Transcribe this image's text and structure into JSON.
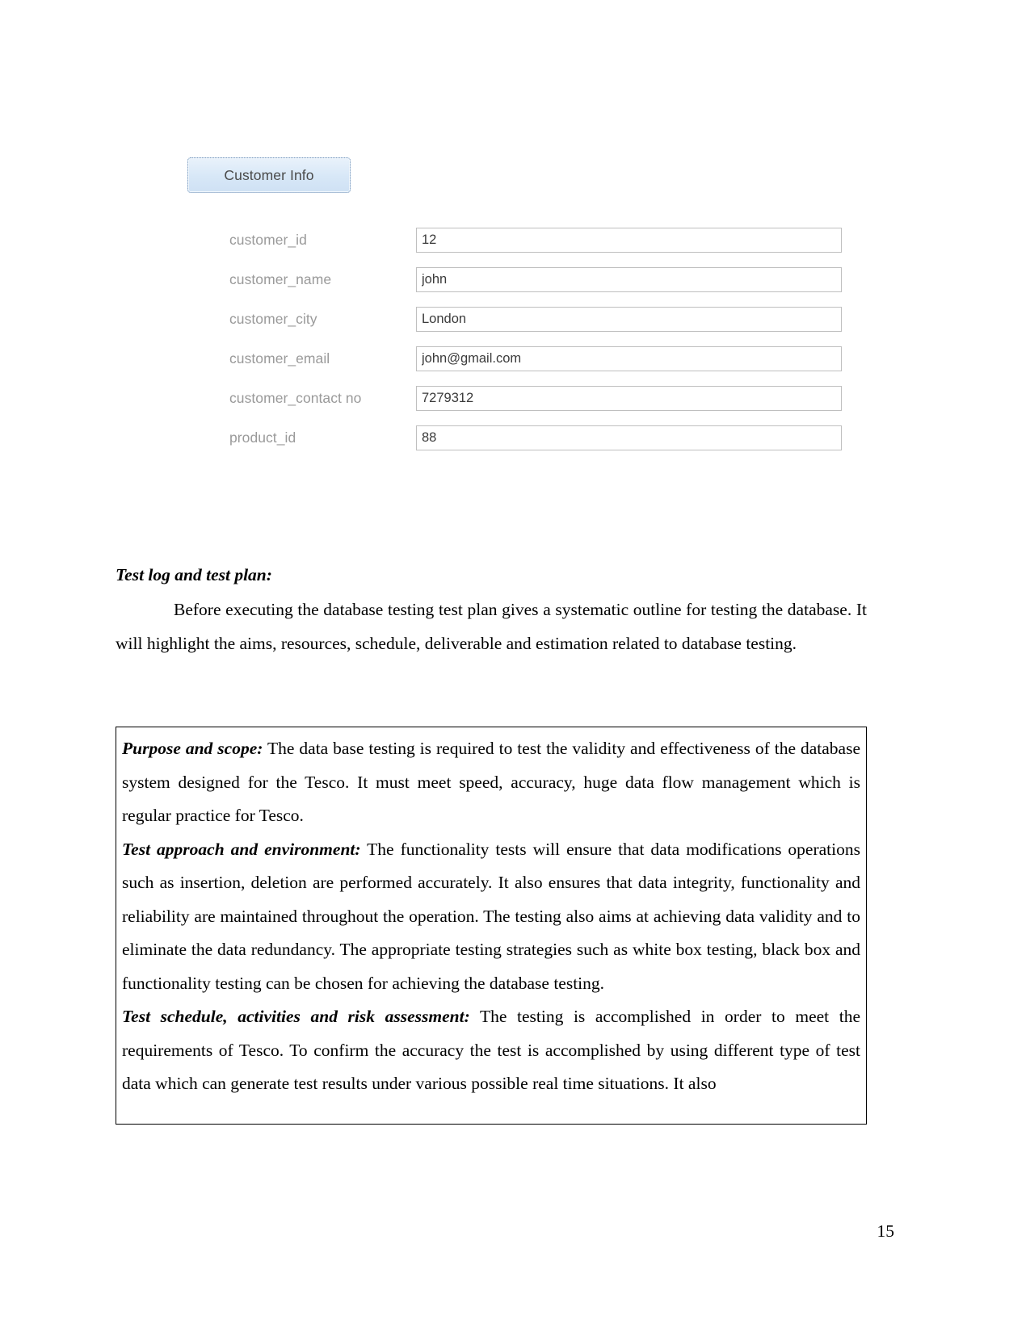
{
  "page": {
    "number": "15"
  },
  "app_screenshot": {
    "tab_label": "Customer Info",
    "accent_color": "#d7e7f7",
    "border_color": "#6f8fb5",
    "label_color": "#9a9a9a",
    "fields": [
      {
        "label": "customer_id",
        "value": "12"
      },
      {
        "label": "customer_name",
        "value": "john"
      },
      {
        "label": "customer_city",
        "value": "London"
      },
      {
        "label": "customer_email",
        "value": "john@gmail.com"
      },
      {
        "label": "customer_contact no",
        "value": "7279312"
      },
      {
        "label": "product_id",
        "value": "88"
      }
    ]
  },
  "document": {
    "section_heading": "Test log and test plan:",
    "intro_paragraph": "Before executing the database testing test plan gives a systematic outline for testing the database. It will highlight the aims, resources, schedule, deliverable and estimation related to database testing.",
    "boxed_blocks": [
      {
        "lead": "Purpose and scope:",
        "text": " The data base testing is required to test the validity and effectiveness of the database system designed for the Tesco. It must meet speed, accuracy, huge data flow management which is regular practice for Tesco."
      },
      {
        "lead": "Test approach and environment:",
        "text": " The functionality tests will ensure that data modifications operations such as insertion, deletion are performed accurately. It also ensures that data integrity, functionality and reliability are maintained throughout the operation. The testing also aims at achieving data validity and to eliminate the data redundancy. The appropriate testing strategies such as white box testing, black box and functionality testing can be chosen for achieving the database testing."
      },
      {
        "lead": "Test schedule, activities and risk assessment:",
        "text": " The testing is accomplished in order to meet the requirements of Tesco. To confirm the accuracy the test is accomplished by using different type of test data which can generate test results under various possible real time situations. It also"
      }
    ]
  }
}
